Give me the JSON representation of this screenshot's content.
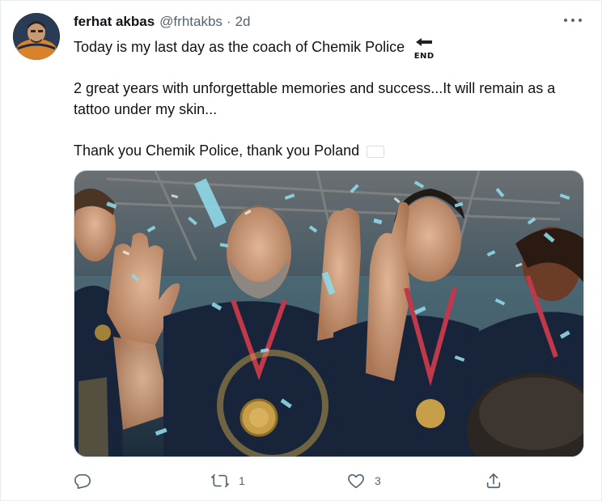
{
  "tweet": {
    "author": {
      "display_name": "ferhat akbas",
      "handle": "@frhtakbs",
      "separator": "·",
      "time": "2d"
    },
    "text": {
      "line1": "Today is my last day as the coach of Chemik Police",
      "line1_emoji_label": "END",
      "line2": "2 great years with unforgettable memories and success...It will remain as a tattoo under my skin...",
      "line3": "Thank you Chemik Police, thank you Poland"
    },
    "actions": {
      "reply_count": "",
      "retweet_count": "1",
      "like_count": "3"
    },
    "icons": {
      "more": "more-horizontal-icon",
      "reply": "reply-icon",
      "retweet": "retweet-icon",
      "like": "heart-icon",
      "share": "share-icon",
      "end_emoji": "end-arrow-emoji",
      "flag": "poland-flag-emoji"
    },
    "colors": {
      "text": "#0f1419",
      "secondary": "#536471",
      "border": "#e6ecf0",
      "flag_red": "#dc143c"
    }
  }
}
